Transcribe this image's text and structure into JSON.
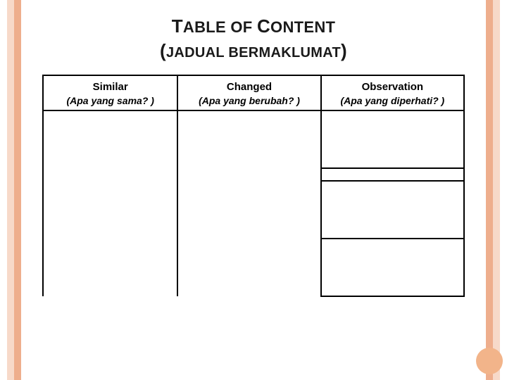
{
  "title": {
    "line1_cap1": "T",
    "line1_rest1": "ABLE",
    "line1_of": " OF ",
    "line1_cap2": "C",
    "line1_rest2": "ONTENT",
    "line2_open": "(",
    "line2_cap1": "J",
    "line2_rest1": "ADUAL",
    "line2_sp": " ",
    "line2_cap2": "B",
    "line2_rest2": "ERMAKLUMAT",
    "line2_close": ")"
  },
  "headers": {
    "similar_en": "Similar",
    "similar_ms": "(Apa yang sama? )",
    "changed_en": "Changed",
    "changed_ms": "(Apa yang berubah? )",
    "observation_en": "Observation",
    "observation_ms": "(Apa yang diperhati? )"
  }
}
